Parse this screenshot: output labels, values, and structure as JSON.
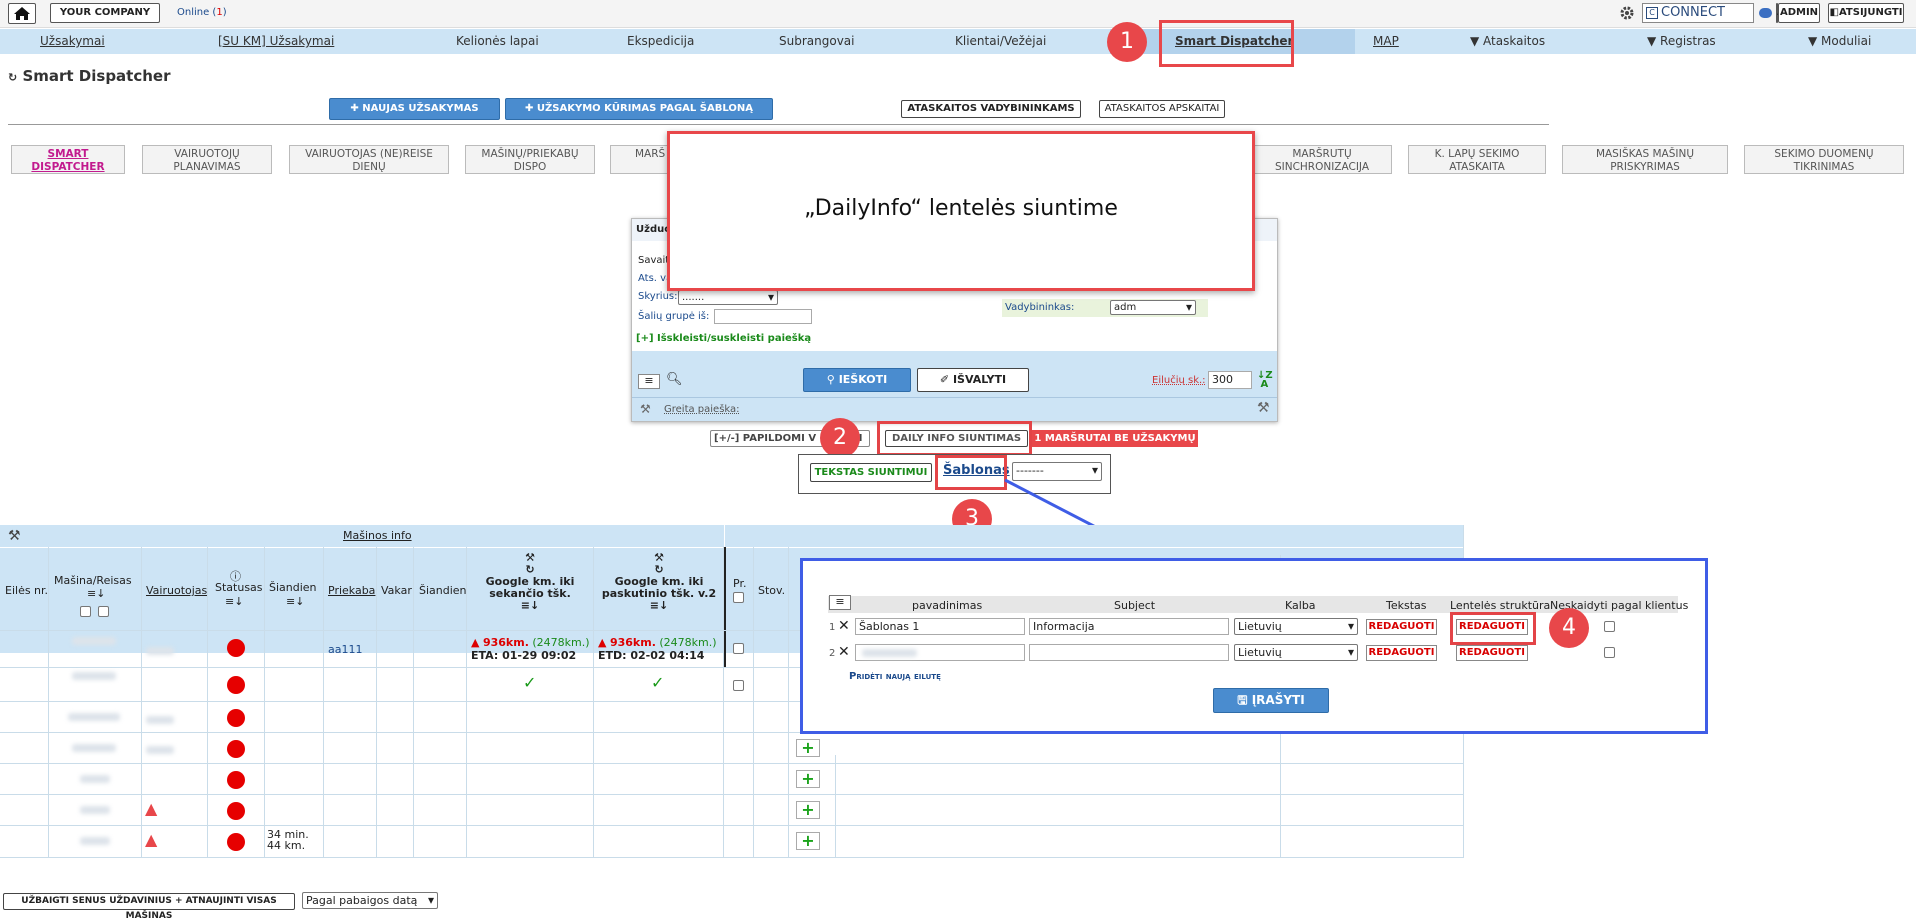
{
  "topbar": {
    "home_icon": "home-icon",
    "company": "YOUR COMPANY",
    "online_label": "Online (",
    "online_count": "1",
    "online_close": ")",
    "connect": "CONNECT",
    "admin": "ADMIN",
    "logout": "ATSIJUNGTI"
  },
  "nav": {
    "items": [
      "Užsakymai",
      "[SU KM] Užsakymai",
      "Kelionės lapai",
      "Ekspedicija",
      "Subrangovai",
      "Klientai/Vežėjai",
      "Smart Dispatcher",
      "MAP",
      "▼ Ataskaitos",
      "▼ Registras",
      "▼ Moduliai"
    ]
  },
  "page": {
    "title": "Smart Dispatcher",
    "new_order": "NAUJAS UŽSAKYMAS",
    "order_by_template": "UŽSAKYMO KŪRIMAS PAGAL ŠABLONĄ",
    "reports_managers": "ATASKAITOS VADYBININKAMS",
    "reports_accounting": "ATASKAITOS APSKAITAI"
  },
  "tabs": [
    "SMART DISPATCHER",
    "VAIRUOTOJŲ PLANAVIMAS",
    "VAIRUOTOJAS (NE)REISE DIENŲ",
    "MAŠINŲ/PRIEKABŲ DISPO",
    "MARŠ",
    "MARŠRUTŲ SINCHRONIZACIJA",
    "K. LAPŲ SEKIMO ATASKAITA",
    "MASIŠKAS MAŠINŲ PRISKYRIMAS",
    "SEKIMO DUOMENŲ TIKRINIMAS"
  ],
  "callout": {
    "text": "„DailyInfo“ lentelės siuntime"
  },
  "search_panel": {
    "title": "Užduo",
    "week_label": "Savait",
    "ats_label": "Ats. va",
    "skyrius_label": "Skyrius:",
    "skyrius_value": ".......",
    "saliu_label": "Šalių grupė iš:",
    "vadybininkas_label": "Vadybininkas:",
    "vadybininkas_value": "adm",
    "expand": "[+] Išskleisti/suskleisti paiešką",
    "search_btn": "IEŠKOTI",
    "clear_btn": "IŠVALYTI",
    "rows_label": "Eilučių sk.:",
    "rows_value": "300",
    "quick_search": "Greita paieška:"
  },
  "actions": {
    "extra": "[+/-] PAPILDOMI V",
    "extra_tail": "AI",
    "daily_info": "DAILY INFO SIUNTIMAS",
    "routes_without": "1 MARŠRUTAI BE UŽSAKYMŲ",
    "text_send": "TEKSTAS SIUNTIMUI",
    "templates": "Šablonas",
    "template_select": "-------"
  },
  "markers": [
    "1",
    "2",
    "3",
    "4"
  ],
  "table": {
    "group_header": "Mašinos info",
    "headers": [
      "Eilės nr.",
      "Mašina/Reisas",
      "Vairuotojas",
      "Statusas",
      "Šiandien",
      "Priekaba",
      "Vakar",
      "Šiandien",
      "Google km. iki sekančio tšk.",
      "Google km. iki paskutinio tšk. v.2",
      "Pr.",
      "Stov."
    ],
    "row1": {
      "trailer": "aa111",
      "next_km": "936km.",
      "next_km2": "(2478km.)",
      "eta": "ETA: 01-29 09:02",
      "last_km": "936km.",
      "last_km2": "(2478km.)",
      "etd": "ETD: 02-02 04:14"
    },
    "row7_today": "34 min.",
    "row7_today2": "44 km."
  },
  "templates_table": {
    "headers": [
      "pavadinimas",
      "Subject",
      "Kalba",
      "Tekstas",
      "Lentelės struktūra",
      "Neskaidyti pagal klientus"
    ],
    "rows": [
      {
        "num": "1",
        "name": "Šablonas 1",
        "subject": "Informacija",
        "lang": "Lietuvių",
        "text_btn": "REDAGUOTI",
        "struct_btn": "REDAGUOTI"
      },
      {
        "num": "2",
        "name": "",
        "subject": "",
        "lang": "Lietuvių",
        "text_btn": "REDAGUOTI",
        "struct_btn": "REDAGUOTI"
      }
    ],
    "add_row": "Pridėti naują eilutę",
    "save": "ĮRAŠYTI"
  },
  "bottom": {
    "close_old": "UŽBAIGTI SENUS UŽDAVINIUS + ATNAUJINTI VISAS MAŠINAS",
    "sort_select": "Pagal pabaigos datą"
  },
  "colors": {
    "accent_red": "#e8474a",
    "nav_bg": "#cde4f5",
    "blue_btn": "#4a8ccf",
    "arrow_blue": "#3f5de6"
  }
}
